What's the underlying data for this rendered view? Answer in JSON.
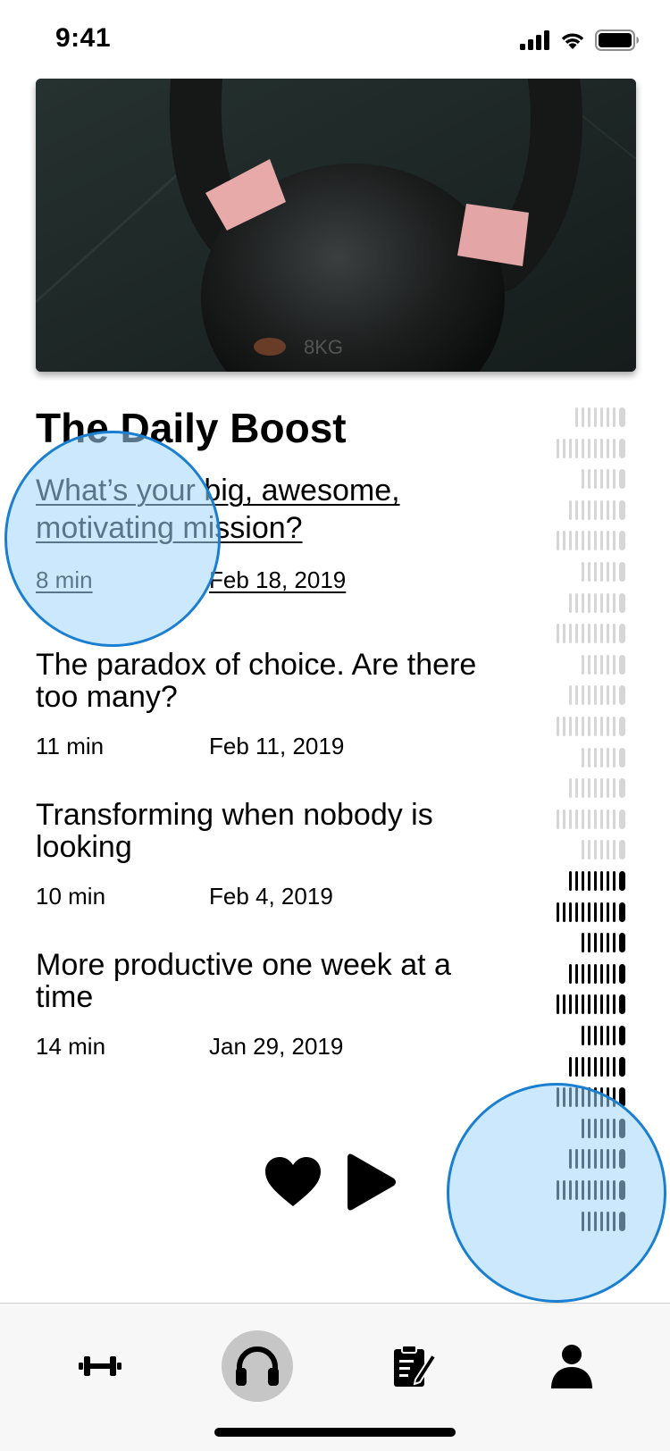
{
  "status_bar": {
    "time": "9:41"
  },
  "podcast": {
    "title": "The Daily Boost"
  },
  "episodes": [
    {
      "title": "What’s your big, awesome, motivating mission?",
      "duration": "8 min",
      "date": "Feb 18, 2019",
      "active": true
    },
    {
      "title": "The paradox of choice. Are there too many?",
      "duration": "11 min",
      "date": "Feb 11, 2019",
      "active": false
    },
    {
      "title": "Transforming when nobody is looking",
      "duration": "10 min",
      "date": "Feb 4, 2019",
      "active": false
    },
    {
      "title": "More productive one week at a time",
      "duration": "14 min",
      "date": "Jan 29, 2019",
      "active": false
    }
  ],
  "player": {
    "like_icon": "heart-icon",
    "play_icon": "play-icon",
    "progress_fraction": 0.43
  },
  "tabs": [
    {
      "name": "workouts",
      "icon": "dumbbell-icon",
      "active": false
    },
    {
      "name": "listen",
      "icon": "headphones-icon",
      "active": true
    },
    {
      "name": "journal",
      "icon": "clipboard-pencil-icon",
      "active": false
    },
    {
      "name": "profile",
      "icon": "person-icon",
      "active": false
    }
  ],
  "colors": {
    "accent_touch": "#a3d6fa",
    "touch_border": "#1a7fd1",
    "waveform_played": "#000000",
    "waveform_unplayed": "#d6d6d6"
  }
}
